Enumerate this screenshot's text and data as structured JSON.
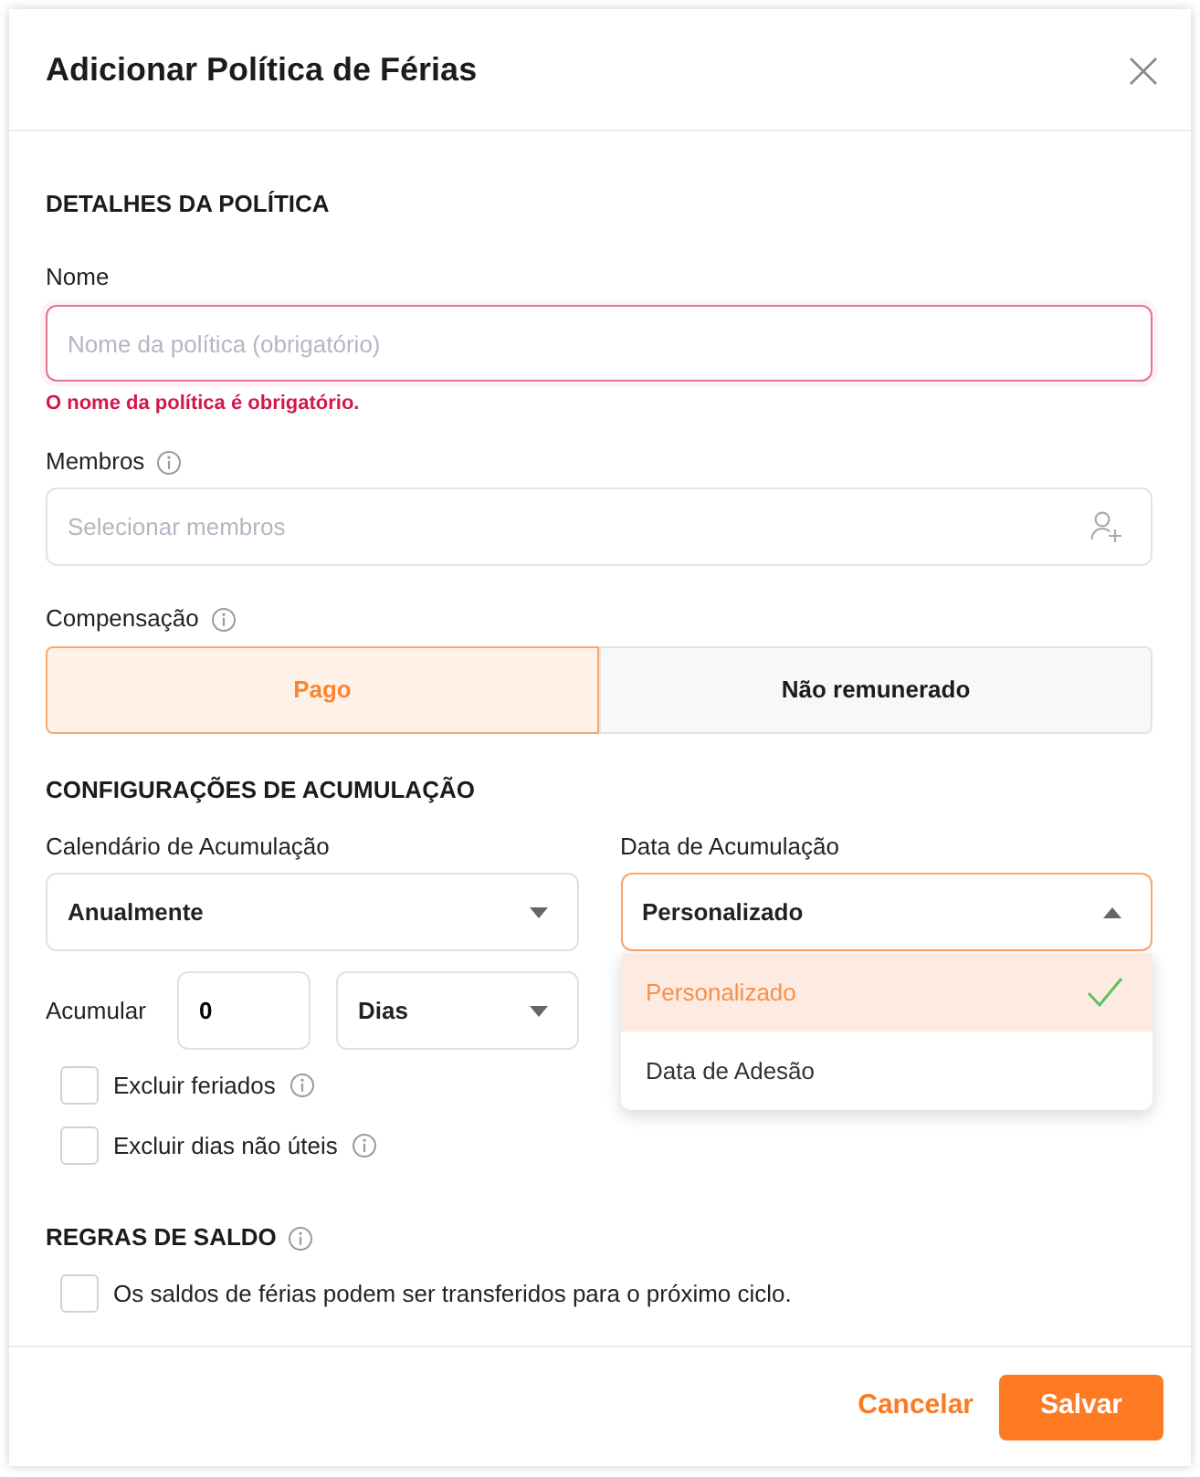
{
  "dialog": {
    "title": "Adicionar Política de Férias"
  },
  "details": {
    "heading": "DETALHES DA POLÍTICA",
    "name": {
      "label": "Nome",
      "placeholder": "Nome da política (obrigatório)",
      "invalid": true,
      "error": "O nome da política é obrigatório."
    },
    "members": {
      "label": "Membros",
      "info": true,
      "placeholder": "Selecionar membros"
    },
    "compensation": {
      "label": "Compensação",
      "info": true,
      "options": [
        {
          "label": "Pago",
          "selected": true
        },
        {
          "label": "Não remunerado",
          "selected": false
        }
      ]
    }
  },
  "accrual": {
    "heading": "CONFIGURAÇÕES DE ACUMULAÇÃO",
    "calendar": {
      "label": "Calendário de Acumulação",
      "value": "Anualmente",
      "expanded": false
    },
    "date": {
      "label": "Data de Acumulação",
      "value": "Personalizado",
      "expanded": true,
      "options": [
        {
          "label": "Personalizado",
          "selected": true
        },
        {
          "label": "Data de Adesão",
          "selected": false
        }
      ]
    },
    "amount": {
      "label": "Acumular",
      "value": "0",
      "unit": {
        "value": "Dias",
        "expanded": false
      }
    },
    "options": [
      {
        "label": "Excluir feriados",
        "checked": false,
        "info": true
      },
      {
        "label": "Excluir dias não úteis",
        "checked": false,
        "info": true
      }
    ]
  },
  "balance": {
    "heading": "REGRAS DE SALDO",
    "info": true,
    "options": [
      {
        "label": "Os saldos de férias podem ser transferidos para o próximo ciclo.",
        "checked": false
      }
    ]
  },
  "footer": {
    "buttons": [
      {
        "kind": "text",
        "label": "Cancelar"
      },
      {
        "kind": "primary",
        "label": "Salvar"
      }
    ]
  }
}
